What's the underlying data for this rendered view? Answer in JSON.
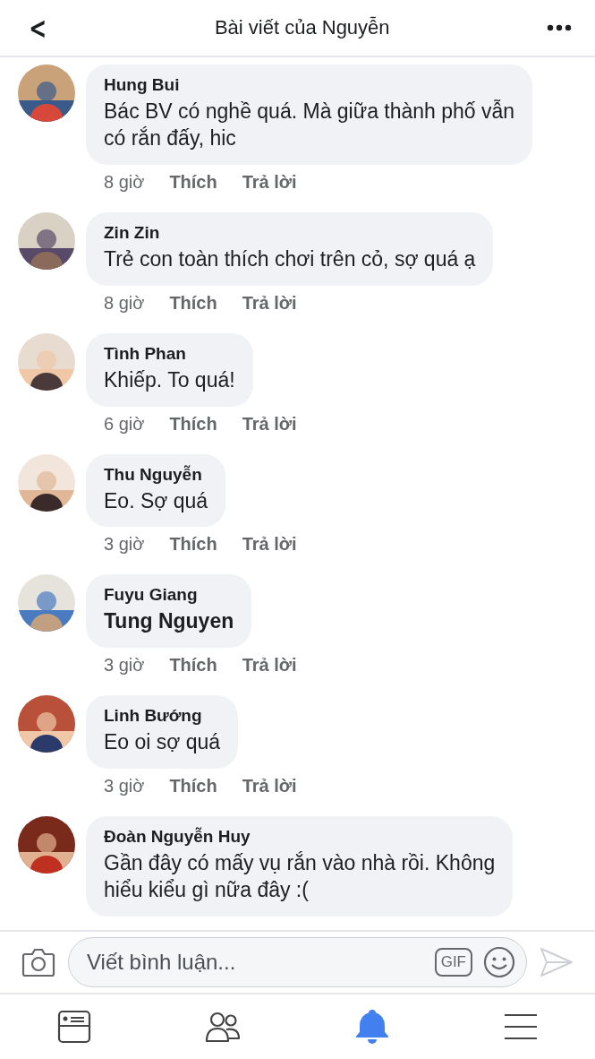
{
  "header": {
    "back": "<",
    "title": "Bài viết của Nguyễn"
  },
  "comments": [
    {
      "author": "Hung Bui",
      "kind": "text",
      "text": "Bác BV có nghề quá. Mà giữa thành phố vẫn\ncó rắn đấy,  hic",
      "time": "8 giờ",
      "like": "Thích",
      "reply": "Trả lời"
    },
    {
      "author": "Zin Zin",
      "kind": "text",
      "text": "Trẻ con toàn thích chơi trên cỏ, sợ quá ạ",
      "time": "8 giờ",
      "like": "Thích",
      "reply": "Trả lời"
    },
    {
      "author": "Tình Phan",
      "kind": "text",
      "text": "Khiếp. To quá!",
      "time": "6 giờ",
      "like": "Thích",
      "reply": "Trả lời"
    },
    {
      "author": "Thu Nguyễn",
      "kind": "text",
      "text": "Eo. Sợ quá",
      "time": "3 giờ",
      "like": "Thích",
      "reply": "Trả lời"
    },
    {
      "author": "Fuyu Giang",
      "kind": "mention",
      "text": "Tung Nguyen",
      "time": "3 giờ",
      "like": "Thích",
      "reply": "Trả lời"
    },
    {
      "author": "Linh Bướng",
      "kind": "text",
      "text": "Eo oi sợ quá",
      "time": "3 giờ",
      "like": "Thích",
      "reply": "Trả lời"
    },
    {
      "author": "Đoàn Nguyễn Huy",
      "kind": "text",
      "text": "Gần đây có mấy vụ rắn vào nhà rồi. Không\nhiểu kiểu gì nữa đây :("
    }
  ],
  "composer": {
    "placeholder": "Viết bình luận...",
    "gif": "GIF"
  },
  "tabs": [
    {
      "kind": "feed",
      "selected": false
    },
    {
      "kind": "friends",
      "selected": false
    },
    {
      "kind": "notifications",
      "selected": true
    },
    {
      "kind": "menu",
      "selected": false
    }
  ]
}
